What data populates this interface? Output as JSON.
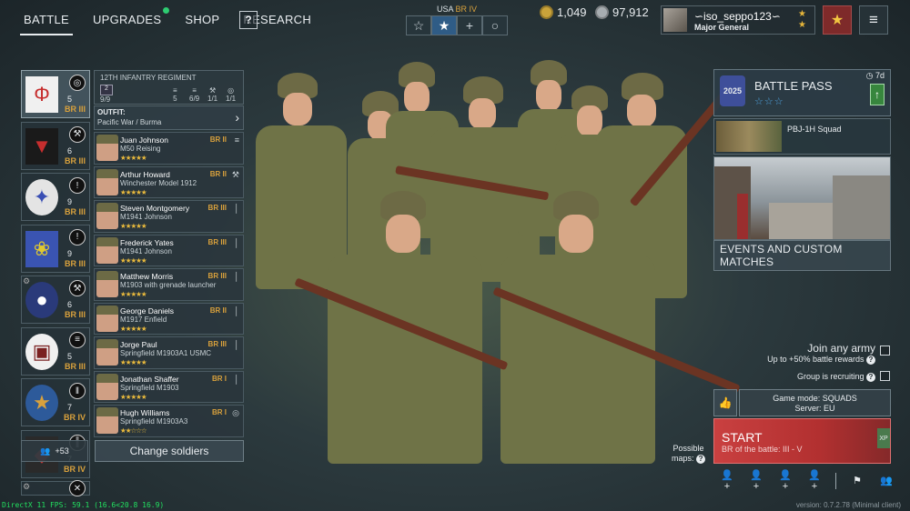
{
  "nav": {
    "battle": "BATTLE",
    "upgrades": "UPGRADES",
    "shop": "SHOP",
    "research": "RESEARCH",
    "help": "?"
  },
  "army": {
    "name": "USA",
    "br": "BR IV",
    "tabs": [
      "☆",
      "★",
      "+",
      "○"
    ],
    "selected_tab": 1
  },
  "currency": {
    "gold": "1,049",
    "silver": "97,912",
    "gold_color": "#c9a33a",
    "silver_color": "#a7adb1"
  },
  "profile": {
    "name": "∽iso_seppo123∽",
    "rank": "Major General"
  },
  "squads": [
    {
      "emblem": "Φ",
      "emblem_color": "#c62e2e",
      "emblem_bg": "#f0f0f0",
      "cls": "◎",
      "count": "5",
      "br": "BR III"
    },
    {
      "emblem": "▼",
      "emblem_color": "#c62e2e",
      "emblem_bg": "#1a1a1a",
      "cls": "⚒",
      "count": "6",
      "br": "BR III"
    },
    {
      "emblem": "✦",
      "emblem_color": "#3a4fb4",
      "emblem_bg": "#e4e4e4",
      "cls": "!",
      "count": "9",
      "br": "BR III"
    },
    {
      "emblem": "❀",
      "emblem_color": "#e0c830",
      "emblem_bg": "#3a54b2",
      "cls": "!",
      "count": "9",
      "br": "BR III"
    },
    {
      "emblem": "●",
      "emblem_color": "#ffffff",
      "emblem_bg": "#2a3a7a",
      "cls": "⚒",
      "count": "6",
      "br": "BR III"
    },
    {
      "emblem": "▣",
      "emblem_color": "#7a2020",
      "emblem_bg": "#f0f0f0",
      "cls": "≡",
      "count": "5",
      "br": "BR III"
    },
    {
      "emblem": "★",
      "emblem_color": "#d9a13c",
      "emblem_bg": "#2d5a9a",
      "cls": "‖",
      "count": "7",
      "br": "BR IV"
    },
    {
      "emblem": "◆",
      "emblem_color": "#c03a3a",
      "emblem_bg": "#2a2a2a",
      "cls": "║",
      "count": "7",
      "br": "BR IV"
    },
    {
      "emblem": "✖",
      "emblem_color": "#ccc",
      "emblem_bg": "#333",
      "cls": "✕",
      "count": "",
      "br": ""
    }
  ],
  "regiment": {
    "title": "12TH INFANTRY REGIMENT",
    "level": "2",
    "slots": "9/9",
    "stats": [
      "5",
      "6/9",
      "1/1",
      "1/1"
    ],
    "stat_labels": [
      "≡",
      "≡",
      "⚒",
      "◎"
    ]
  },
  "outfit": {
    "label": "OUTFIT:",
    "value": "Pacific War / Burma"
  },
  "soldiers": [
    {
      "name": "Juan Johnson",
      "weapon": "M50 Reising",
      "br": "BR II",
      "side": "≡",
      "stars": "★★★★★"
    },
    {
      "name": "Arthur Howard",
      "weapon": "Winchester Model 1912",
      "br": "BR II",
      "side": "⚒",
      "stars": "★★★★★"
    },
    {
      "name": "Steven Montgomery",
      "weapon": "M1941 Johnson",
      "br": "BR III",
      "side": "│",
      "stars": "★★★★★"
    },
    {
      "name": "Frederick Yates",
      "weapon": "M1941 Johnson",
      "br": "BR III",
      "side": "│",
      "stars": "★★★★★"
    },
    {
      "name": "Matthew Morris",
      "weapon": "M1903 with grenade launcher",
      "br": "BR III",
      "side": "│",
      "stars": "★★★★★"
    },
    {
      "name": "George Daniels",
      "weapon": "M1917 Enfield",
      "br": "BR II",
      "side": "│",
      "stars": "★★★★★"
    },
    {
      "name": "Jorge Paul",
      "weapon": "Springfield M1903A1 USMC",
      "br": "BR III",
      "side": "│",
      "stars": "★★★★★"
    },
    {
      "name": "Jonathan Shaffer",
      "weapon": "Springfield M1903",
      "br": "BR I",
      "side": "│",
      "stars": "★★★★★"
    },
    {
      "name": "Hugh Williams",
      "weapon": "Springfield M1903A3",
      "br": "BR I",
      "side": "◎",
      "stars": "★★☆☆☆"
    }
  ],
  "reserve": {
    "count": "+53"
  },
  "change_soldiers": "Change soldiers",
  "battle_pass": {
    "title": "BATTLE PASS",
    "time": "7d",
    "stars": "☆☆☆",
    "badge": "2025"
  },
  "promo": {
    "title": "PBJ-1H Squad"
  },
  "events_label": "EVENTS AND CUSTOM MATCHES",
  "join_any": {
    "label": "Join any army",
    "sub": "Up to +50% battle rewards"
  },
  "group_recruiting": "Group is recruiting",
  "game_mode": {
    "mode": "Game mode: SQUADS",
    "server": "Server: EU"
  },
  "start": {
    "label": "START",
    "sub": "BR of the battle: III - V",
    "xp": "XP"
  },
  "maps": {
    "label": "Possible\nmaps:"
  },
  "fps": "DirectX 11 FPS: 59.1 (16.6<20.8 16.9)",
  "version": "version: 0.7.2.78 (Minimal client)"
}
